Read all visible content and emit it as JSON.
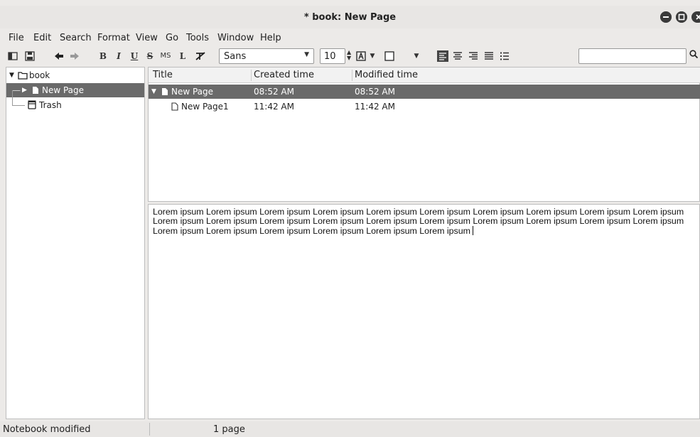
{
  "window": {
    "title": "* book: New Page",
    "controls": {
      "minimize": "⊖",
      "maximize": "⊙",
      "close": "⊗"
    }
  },
  "menu": {
    "items": [
      "File",
      "Edit",
      "Search",
      "Format",
      "View",
      "Go",
      "Tools",
      "Window",
      "Help"
    ]
  },
  "toolbar": {
    "bold": "B",
    "italic": "I",
    "underline": "U",
    "strike": "S",
    "mono": "MS",
    "link": "L",
    "font_family": "Sans",
    "font_size": "10",
    "search_value": ""
  },
  "tree": {
    "notebook": "book",
    "page": "New Page",
    "trash": "Trash"
  },
  "list": {
    "columns": [
      "Title",
      "Created time",
      "Modified time"
    ],
    "rows": [
      {
        "title": "New Page",
        "created": "08:52 AM",
        "modified": "08:52 AM"
      },
      {
        "title": "New Page1",
        "created": "11:42 AM",
        "modified": "11:42 AM"
      }
    ]
  },
  "editor": {
    "text": "Lorem ipsum Lorem ipsum Lorem ipsum Lorem ipsum Lorem ipsum Lorem ipsum Lorem ipsum Lorem ipsum Lorem ipsum Lorem ipsum Lorem ipsum Lorem ipsum Lorem ipsum Lorem ipsum Lorem ipsum Lorem ipsum Lorem ipsum Lorem ipsum Lorem ipsum Lorem ipsum Lorem ipsum Lorem ipsum Lorem ipsum Lorem ipsum Lorem ipsum Lorem ipsum"
  },
  "status": {
    "left": "Notebook modified",
    "pages": "1 page"
  },
  "colors": {
    "selection": "#6a6a6a",
    "window_bg": "#eceae8"
  }
}
